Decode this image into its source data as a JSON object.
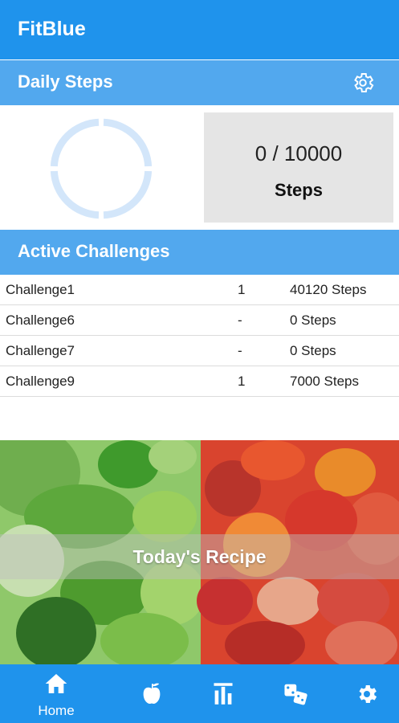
{
  "app": {
    "title": "FitBlue"
  },
  "daily_steps": {
    "header": "Daily Steps",
    "count_text": "0 / 10000",
    "unit_label": "Steps",
    "progress": 0
  },
  "challenges": {
    "header": "Active Challenges",
    "rows": [
      {
        "name": "Challenge1",
        "count": "1",
        "steps": "40120 Steps"
      },
      {
        "name": "Challenge6",
        "count": "-",
        "steps": "0 Steps"
      },
      {
        "name": "Challenge7",
        "count": "-",
        "steps": "0 Steps"
      },
      {
        "name": "Challenge9",
        "count": "1",
        "steps": "7000 Steps"
      }
    ]
  },
  "recipe": {
    "label": "Today's Recipe"
  },
  "bottom_nav": {
    "items": [
      {
        "icon": "home-icon",
        "label": "Home",
        "active": true
      },
      {
        "icon": "apple-icon",
        "label": ""
      },
      {
        "icon": "bar-chart-icon",
        "label": ""
      },
      {
        "icon": "dice-icon",
        "label": ""
      },
      {
        "icon": "gear-icon",
        "label": ""
      }
    ]
  },
  "colors": {
    "primary": "#1f93ec",
    "section_header": "#52a8ee",
    "ring_track": "#d3e6fa",
    "steps_box": "#e5e5e5"
  }
}
